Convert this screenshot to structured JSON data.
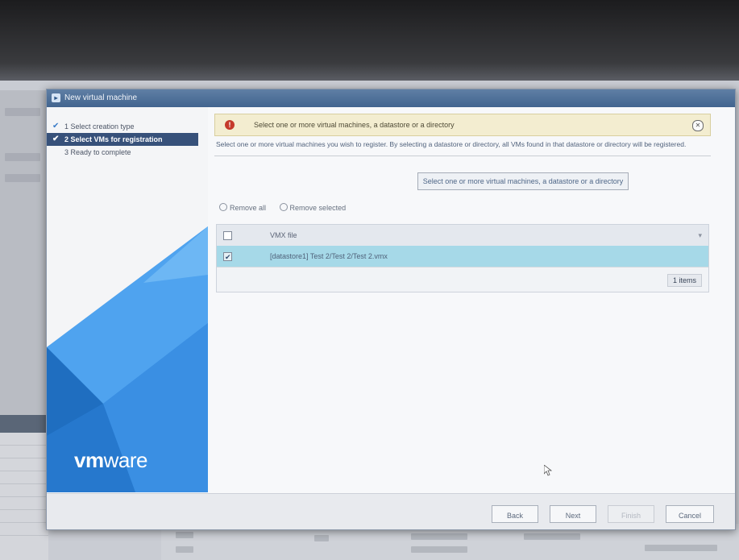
{
  "dialog": {
    "title": "New virtual machine"
  },
  "steps": [
    {
      "label": "1 Select creation type",
      "done": true
    },
    {
      "label": "2 Select VMs for registration",
      "done": true,
      "active": true
    },
    {
      "label": "3 Ready to complete",
      "done": false
    }
  ],
  "brand": {
    "logo_bold": "vm",
    "logo_rest": "ware"
  },
  "banner": {
    "message": "Select one or more virtual machines, a datastore or a directory",
    "icon": "error-icon"
  },
  "instructions": "Select one or more virtual machines you wish to register. By selecting a datastore or directory, all VMs found in that datastore or directory will be registered.",
  "select_button": "Select one or more virtual machines, a datastore or a directory",
  "actions": {
    "remove_all": "Remove all",
    "remove_selected": "Remove selected"
  },
  "table": {
    "header": "VMX file",
    "rows": [
      {
        "value": "[datastore1] Test 2/Test 2/Test 2.vmx",
        "checked": true
      }
    ],
    "count": "1 items"
  },
  "footer": {
    "back": "Back",
    "next": "Next",
    "finish": "Finish",
    "cancel": "Cancel"
  },
  "colors": {
    "brand_blue": "#2e7fd6",
    "selected_row": "#a6d9e8",
    "error_red": "#c53a2b",
    "active_step": "#37517a"
  }
}
